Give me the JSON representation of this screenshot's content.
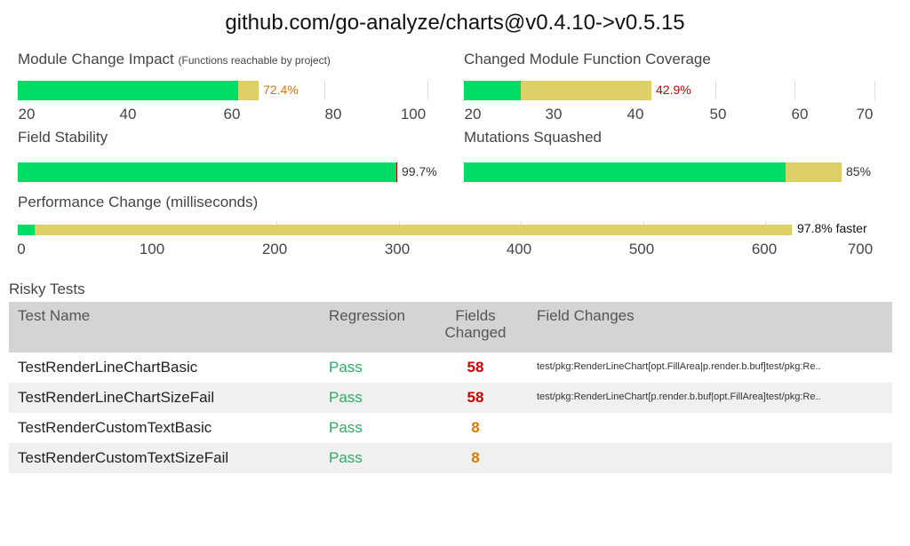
{
  "title": "github.com/go-analyze/charts@v0.4.10->v0.5.15",
  "colors": {
    "pass": "#00dd66",
    "neutral": "#ddd066",
    "bad": "#cc0000",
    "warn": "#dd7700",
    "pass_text": "#33aa66"
  },
  "panels": {
    "module_change_impact": {
      "title": "Module Change Impact",
      "subtitle": "(Functions reachable by project)",
      "label": "72.4%",
      "label_color": "#dd7700",
      "ticks": [
        "20",
        "40",
        "60",
        "80",
        "100"
      ]
    },
    "changed_module_function_coverage": {
      "title": "Changed Module Function Coverage",
      "label": "42.9%",
      "label_color": "#cc0000",
      "ticks": [
        "20",
        "30",
        "40",
        "50",
        "60",
        "70"
      ]
    },
    "field_stability": {
      "title": "Field Stability",
      "label": "99.7%",
      "label_color": "#333333"
    },
    "mutations_squashed": {
      "title": "Mutations Squashed",
      "label": "85%",
      "label_color": "#333333"
    },
    "performance_change": {
      "title": "Performance Change (milliseconds)",
      "label": "97.8% faster",
      "label_color": "#111111",
      "ticks": [
        "0",
        "100",
        "200",
        "300",
        "400",
        "500",
        "600",
        "700"
      ]
    }
  },
  "risky_tests": {
    "title": "Risky Tests",
    "headers": {
      "name": "Test Name",
      "regression": "Regression",
      "fields_line1": "Fields",
      "fields_line2": "Changed",
      "changes": "Field Changes"
    },
    "rows": [
      {
        "name": "TestRenderLineChartBasic",
        "regression": "Pass",
        "fields": "58",
        "fields_color": "#cc0000",
        "changes": "test/pkg:RenderLineChart[opt.FillArea|p.render.b.buf]test/pkg:Re.."
      },
      {
        "name": "TestRenderLineChartSizeFail",
        "regression": "Pass",
        "fields": "58",
        "fields_color": "#cc0000",
        "changes": "test/pkg:RenderLineChart[p.render.b.buf|opt.FillArea]test/pkg:Re.."
      },
      {
        "name": "TestRenderCustomTextBasic",
        "regression": "Pass",
        "fields": "8",
        "fields_color": "#dd7700",
        "changes": ""
      },
      {
        "name": "TestRenderCustomTextSizeFail",
        "regression": "Pass",
        "fields": "8",
        "fields_color": "#dd7700",
        "changes": ""
      }
    ]
  }
}
